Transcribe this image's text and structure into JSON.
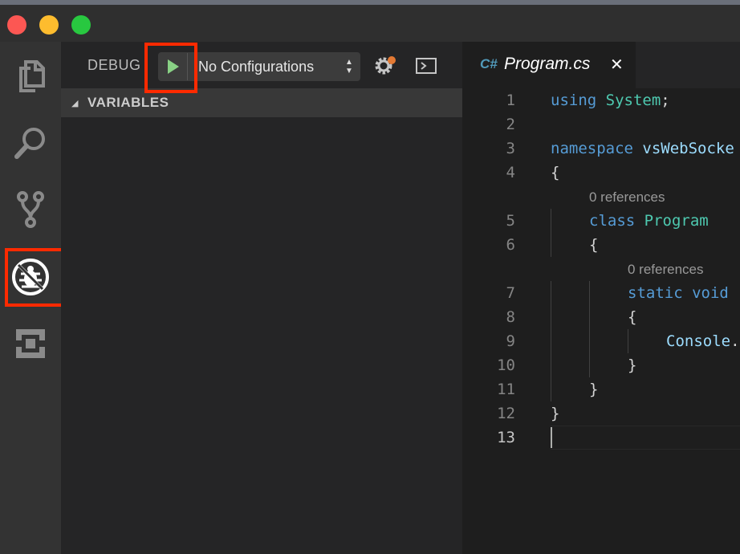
{
  "window": {
    "controls": [
      "close",
      "minimize",
      "maximize"
    ]
  },
  "activity_bar": {
    "items": [
      {
        "icon": "files-icon",
        "active": false
      },
      {
        "icon": "search-icon",
        "active": false
      },
      {
        "icon": "source-control-icon",
        "active": false
      },
      {
        "icon": "debug-icon",
        "active": true,
        "highlighted": true
      },
      {
        "icon": "extensions-icon",
        "active": false
      }
    ]
  },
  "debug": {
    "title": "DEBUG",
    "configuration": "No Configurations",
    "play_highlighted": true,
    "settings_badge_color": "#e37933"
  },
  "sidebar": {
    "section_title": "VARIABLES"
  },
  "editor": {
    "tab_icon": "C#",
    "tab_label": "Program.cs",
    "tab_close": "✕",
    "line_numbers": [
      "1",
      "2",
      "3",
      "4",
      "5",
      "6",
      "7",
      "8",
      "9",
      "10",
      "11",
      "12",
      "13"
    ],
    "active_line": "13",
    "lens": {
      "class_refs": "0 references",
      "method_refs": "0 references"
    }
  },
  "colors": {
    "highlight": "#ff2a00",
    "keyword": "#569cd6",
    "type": "#4ec9b0",
    "identifier": "#9cdcfe",
    "play": "#89d185"
  }
}
